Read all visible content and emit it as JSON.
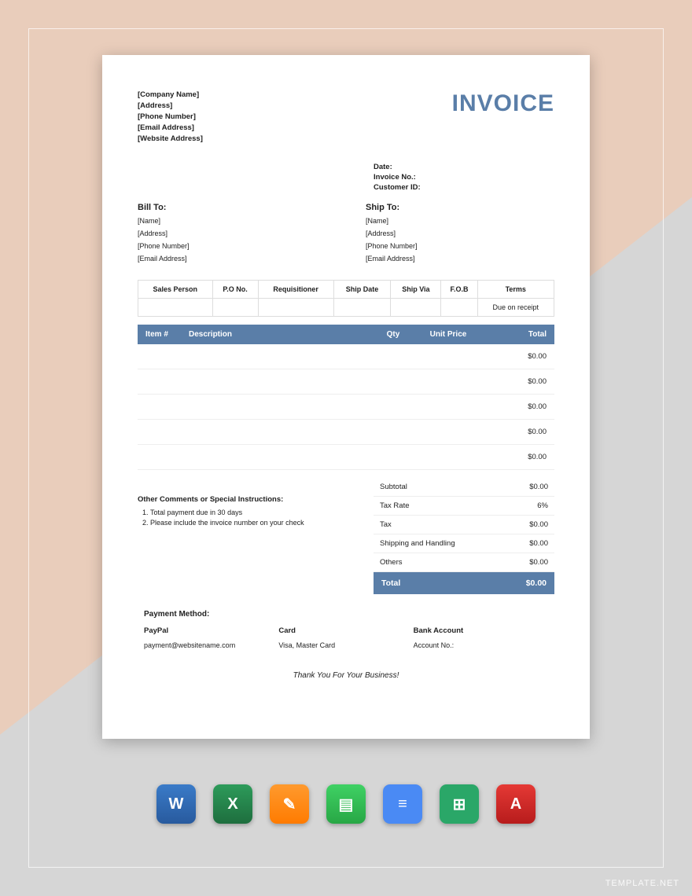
{
  "company": {
    "name": "[Company Name]",
    "address": "[Address]",
    "phone": "[Phone Number]",
    "email": "[Email Address]",
    "website": "[Website Address]"
  },
  "title": "INVOICE",
  "meta": {
    "date_label": "Date:",
    "invoice_no_label": "Invoice No.:",
    "customer_id_label": "Customer ID:"
  },
  "billto": {
    "title": "Bill To:",
    "name": "[Name]",
    "address": "[Address]",
    "phone": "[Phone Number]",
    "email": "[Email Address]"
  },
  "shipto": {
    "title": "Ship To:",
    "name": "[Name]",
    "address": "[Address]",
    "phone": "[Phone Number]",
    "email": "[Email Address]"
  },
  "ship_headers": {
    "salesperson": "Sales Person",
    "po": "P.O No.",
    "requisitioner": "Requisitioner",
    "shipdate": "Ship Date",
    "shipvia": "Ship Via",
    "fob": "F.O.B",
    "terms": "Terms"
  },
  "ship_values": {
    "terms": "Due on receipt"
  },
  "items_headers": {
    "item": "Item #",
    "description": "Description",
    "qty": "Qty",
    "unitprice": "Unit Price",
    "total": "Total"
  },
  "item_rows": [
    {
      "total": "$0.00"
    },
    {
      "total": "$0.00"
    },
    {
      "total": "$0.00"
    },
    {
      "total": "$0.00"
    },
    {
      "total": "$0.00"
    }
  ],
  "comments": {
    "title": "Other Comments or Special Instructions:",
    "line1": "Total payment due in 30 days",
    "line2": "Please include the invoice number on your check"
  },
  "totals": {
    "subtotal_label": "Subtotal",
    "subtotal_value": "$0.00",
    "taxrate_label": "Tax Rate",
    "taxrate_value": "6%",
    "tax_label": "Tax",
    "tax_value": "$0.00",
    "shipping_label": "Shipping and Handling",
    "shipping_value": "$0.00",
    "others_label": "Others",
    "others_value": "$0.00",
    "total_label": "Total",
    "total_value": "$0.00"
  },
  "payment": {
    "title": "Payment Method:",
    "paypal_label": "PayPal",
    "paypal_value": "payment@websitename.com",
    "card_label": "Card",
    "card_value": "Visa, Master Card",
    "bank_label": "Bank Account",
    "bank_value": "Account No.:"
  },
  "thanks": "Thank You For Your Business!",
  "icons": {
    "word": "W",
    "excel": "X",
    "pages": "✎",
    "numbers": "▤",
    "docs": "≡",
    "sheets": "⊞",
    "pdf": "A"
  },
  "watermark": "TEMPLATE.NET"
}
